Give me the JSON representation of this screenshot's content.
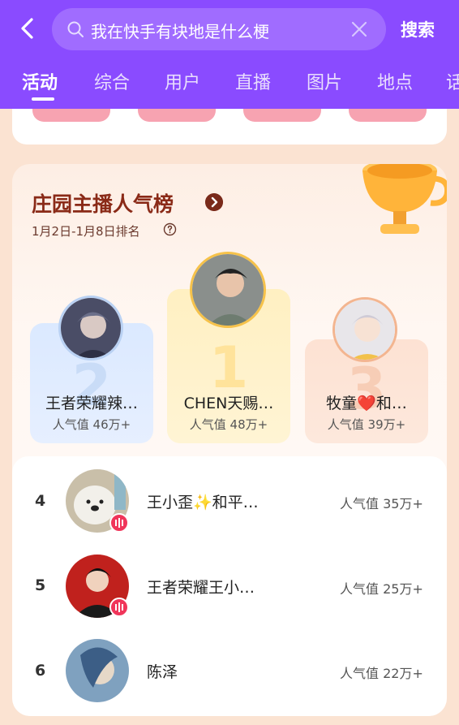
{
  "search": {
    "query": "我在快手有块地是什么梗",
    "button_label": "搜索"
  },
  "tabs": [
    {
      "label": "活动"
    },
    {
      "label": "综合"
    },
    {
      "label": "用户"
    },
    {
      "label": "直播"
    },
    {
      "label": "图片"
    },
    {
      "label": "地点"
    }
  ],
  "ranking": {
    "title": "庄园主播人气榜",
    "subtitle": "1月2日-1月8日排名",
    "podium": [
      {
        "rank": "2",
        "name": "王者荣耀辣…",
        "popularity": "人气值 46万+"
      },
      {
        "rank": "1",
        "name": "CHEN天赐…",
        "popularity": "人气值 48万+"
      },
      {
        "rank": "3",
        "name": "牧童❤️和…",
        "popularity": "人气值 39万+"
      }
    ],
    "list": [
      {
        "rank": "4",
        "name": "王小歪✨和平…",
        "popularity": "人气值 35万+"
      },
      {
        "rank": "5",
        "name": "王者荣耀王小…",
        "popularity": "人气值 25万+"
      },
      {
        "rank": "6",
        "name": "陈泽",
        "popularity": "人气值 22万+"
      }
    ]
  },
  "colors": {
    "header_bg": "#8a4bff",
    "title_color": "#8a2a17",
    "live_badge": "#f0355a"
  },
  "icons": {
    "back": "chevron-left-icon",
    "search": "search-icon",
    "clear": "close-icon",
    "info": "question-circle-icon",
    "title_arrow": "chevron-right-icon",
    "trophy": "trophy-icon",
    "live": "live-bars-icon"
  }
}
